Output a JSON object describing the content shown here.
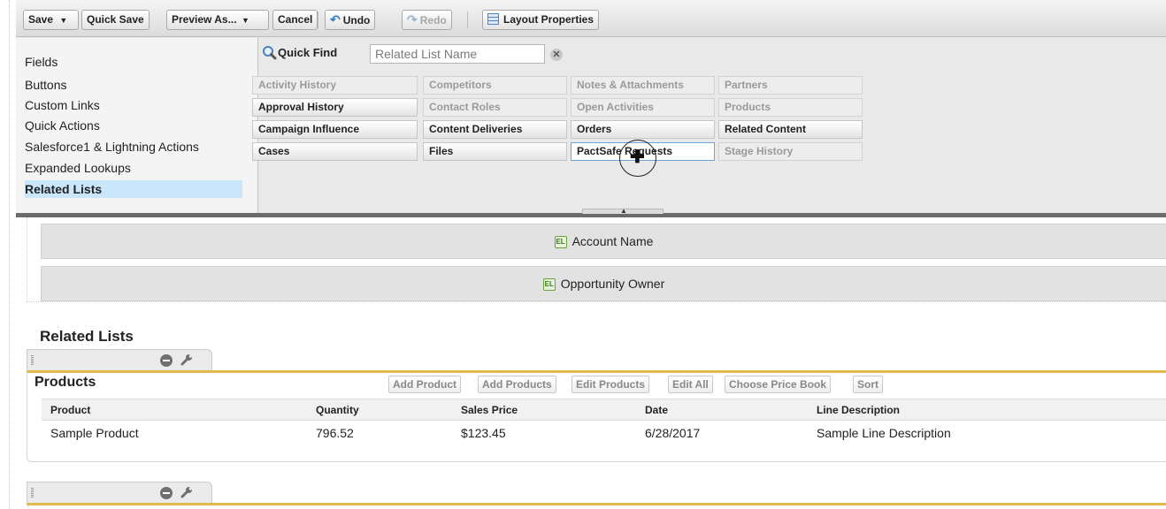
{
  "toolbar": {
    "save": "Save",
    "save_menu": "▼",
    "quick_save": "Quick Save",
    "preview_as": "Preview As...",
    "preview_menu": "▼",
    "cancel": "Cancel",
    "undo": "Undo",
    "redo": "Redo",
    "layout_properties": "Layout Properties"
  },
  "palette": {
    "categories": [
      "Fields",
      "Buttons",
      "Custom Links",
      "Quick Actions",
      "Salesforce1 & Lightning Actions",
      "Expanded Lookups",
      "Related Lists"
    ],
    "selected_category": "Related Lists",
    "quick_find_label": "Quick Find",
    "quick_find_placeholder": "Related List Name",
    "tiles": [
      [
        "Activity History",
        "Competitors",
        "Notes & Attachments",
        "Partners"
      ],
      [
        "Approval History",
        "Contact Roles",
        "Open Activities",
        "Products"
      ],
      [
        "Campaign Influence",
        "Content Deliveries",
        "Orders",
        "Related Content"
      ],
      [
        "Cases",
        "Files",
        "PactSafe Requests",
        "Stage History"
      ]
    ]
  },
  "detail_fields": [
    {
      "badge": "EL",
      "label": "Account Name"
    },
    {
      "badge": "EL",
      "label": "Opportunity Owner"
    }
  ],
  "related_lists": {
    "title": "Related Lists",
    "products": {
      "name": "Products",
      "buttons": [
        "Add Product",
        "Add Products",
        "Edit Products",
        "Edit All",
        "Choose Price Book",
        "Sort"
      ],
      "columns": [
        "Product",
        "Quantity",
        "Sales Price",
        "Date",
        "Line Description"
      ],
      "row": [
        "Sample Product",
        "796.52",
        "$123.45",
        "6/28/2017",
        "Sample Line Description"
      ]
    }
  }
}
